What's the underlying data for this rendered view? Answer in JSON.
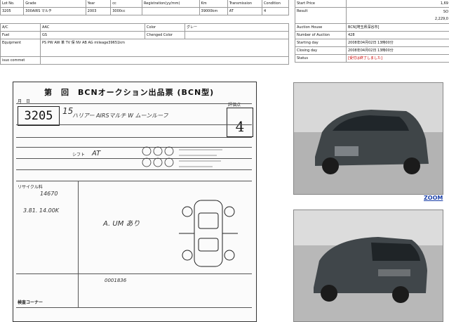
{
  "left_table": {
    "headers": [
      "Lot No.",
      "Grade",
      "Year",
      "cc",
      "Registration(yy/mm)",
      "Km",
      "Transmission",
      "Condition"
    ],
    "values": [
      "3205",
      "300AIRS マルチ",
      "2003",
      "3000cc",
      "",
      "39000km",
      "AT",
      "4"
    ],
    "ac_label": "A/C",
    "ac_value": "AAC",
    "color_label": "Color",
    "color_value": "グレー",
    "fuel_label": "Fuel",
    "fuel_value": "GS",
    "changed_color_label": "Chenged Color",
    "changed_color_value": "",
    "equipment_label": "Equipment",
    "equipment_value": "PS PW AW 革 TV 保 NV AB AG mileage39651km",
    "comment_label": "isuo commet",
    "comment_value": ""
  },
  "right_table": {
    "start_price_label": "Start Price",
    "start_price_value": "1,69",
    "result_label": "Result",
    "result_value_1": "SO",
    "result_value_2": "2,229,0",
    "auction_house_label": "Auction House",
    "auction_house_value": "BCN[埼玉県深谷市]",
    "number_label": "Number of Auction",
    "number_value": "428",
    "starting_label": "Starting day",
    "starting_value": "2008年04月02日 13時00分",
    "closing_label": "Closing day",
    "closing_value": "2008年04月02日 13時00分",
    "status_label": "Status",
    "status_value": "[受付は終了しました]"
  },
  "sheet": {
    "title": "第　回　BCNオークション出品票 (BCN型)",
    "lot": "3205",
    "grade": "4",
    "model_hand": "ハリアー  AIRSマルチ  W  ムーンルーフ",
    "grade_label": "評価点",
    "shift": "シフト",
    "shift_val": "AT",
    "recycle": "リサイクル料",
    "recycle_val": "14670",
    "note": "ムーンルーフ",
    "odometer": "0001836",
    "bottom": "検査コーナー",
    "handwrite_1": "3.81. 14.00K",
    "handwrite_2": "A. UM あり"
  },
  "zoom_label": "ZOOM"
}
